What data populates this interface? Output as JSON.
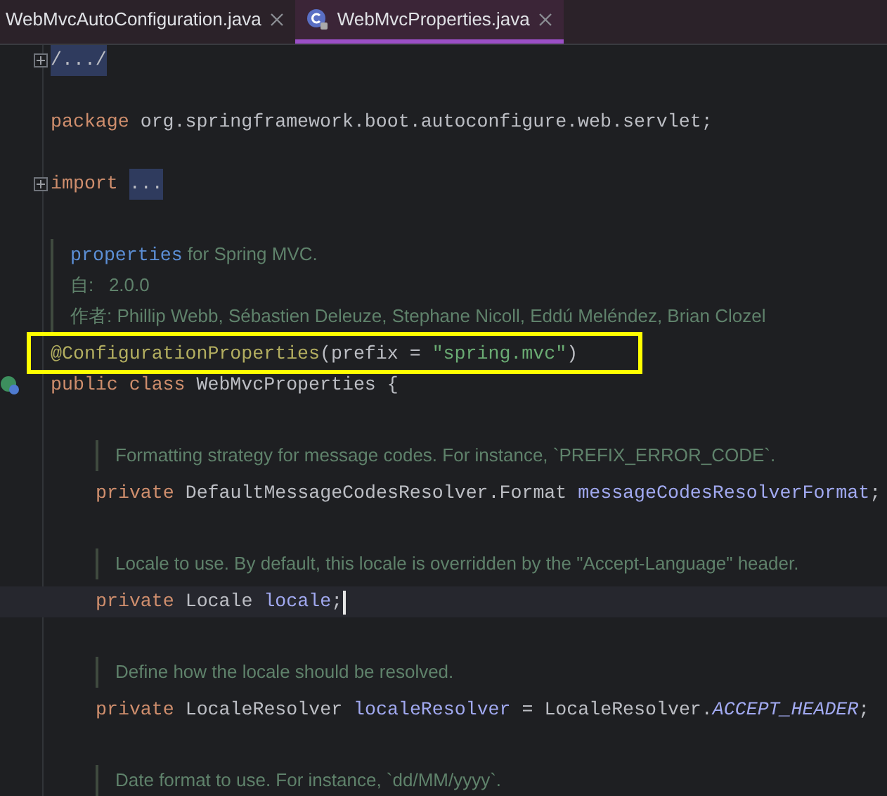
{
  "tabs": [
    {
      "label": "WebMvcAutoConfiguration.java",
      "selected": false
    },
    {
      "label": "WebMvcProperties.java",
      "selected": true
    }
  ],
  "lines": [
    {
      "kind": "code",
      "fold": true,
      "tokens": [
        {
          "kind": "folded",
          "text": "/.../"
        }
      ]
    },
    {
      "kind": "blank"
    },
    {
      "kind": "code",
      "tokens": [
        {
          "kind": "keyword",
          "text": "package "
        },
        {
          "kind": "plain",
          "text": "org.springframework.boot.autoconfigure.web.servlet;"
        }
      ]
    },
    {
      "kind": "blank"
    },
    {
      "kind": "code",
      "fold": true,
      "tokens": [
        {
          "kind": "keyword",
          "text": "import "
        },
        {
          "kind": "folded",
          "text": "..."
        }
      ]
    },
    {
      "kind": "blank"
    },
    {
      "kind": "doc",
      "rows": [
        [
          {
            "kind": "link",
            "text": "properties"
          },
          {
            "kind": "text",
            "text": " for Spring MVC."
          }
        ],
        [
          {
            "kind": "text",
            "text": "自:   2.0.0"
          }
        ],
        [
          {
            "kind": "text",
            "text": "作者: Phillip Webb, Sébastien Deleuze, Stephane Nicoll, Eddú Meléndez, Brian Clozel"
          }
        ]
      ]
    },
    {
      "kind": "code",
      "boxed": true,
      "tokens": [
        {
          "kind": "annotation",
          "text": "@ConfigurationProperties"
        },
        {
          "kind": "plain",
          "text": "(prefix = "
        },
        {
          "kind": "string",
          "text": "\"spring.mvc\""
        },
        {
          "kind": "plain",
          "text": ")"
        }
      ]
    },
    {
      "kind": "code",
      "gutter": true,
      "tokens": [
        {
          "kind": "keyword",
          "text": "public class "
        },
        {
          "kind": "plain",
          "text": "WebMvcProperties {"
        }
      ],
      "children": [
        {
          "kind": "blank"
        },
        {
          "kind": "doc",
          "rows": [
            [
              {
                "kind": "text",
                "text": "Formatting strategy for message codes. For instance, `PREFIX_ERROR_CODE`."
              }
            ]
          ]
        },
        {
          "kind": "code",
          "tokens": [
            {
              "kind": "keyword",
              "text": "private "
            },
            {
              "kind": "plain",
              "text": "DefaultMessageCodesResolver.Format "
            },
            {
              "kind": "field",
              "text": "messageCodesResolverFormat"
            },
            {
              "kind": "plain",
              "text": ";"
            }
          ]
        },
        {
          "kind": "blank"
        },
        {
          "kind": "doc",
          "rows": [
            [
              {
                "kind": "text",
                "text": "Locale to use. By default, this locale is overridden by the \"Accept-Language\" header."
              }
            ]
          ]
        },
        {
          "kind": "code",
          "current": true,
          "tokens": [
            {
              "kind": "keyword",
              "text": "private "
            },
            {
              "kind": "plain",
              "text": "Locale "
            },
            {
              "kind": "field",
              "text": "locale"
            },
            {
              "kind": "plain",
              "text": ";"
            }
          ]
        },
        {
          "kind": "blank"
        },
        {
          "kind": "doc",
          "rows": [
            [
              {
                "kind": "text",
                "text": "Define how the locale should be resolved."
              }
            ]
          ]
        },
        {
          "kind": "code",
          "tokens": [
            {
              "kind": "keyword",
              "text": "private "
            },
            {
              "kind": "plain",
              "text": "LocaleResolver "
            },
            {
              "kind": "field",
              "text": "localeResolver"
            },
            {
              "kind": "plain",
              "text": " = LocaleResolver."
            },
            {
              "kind": "constant",
              "text": "ACCEPT_HEADER"
            },
            {
              "kind": "plain",
              "text": ";"
            }
          ]
        },
        {
          "kind": "blank"
        },
        {
          "kind": "doc",
          "rows": [
            [
              {
                "kind": "text",
                "text": "Date format to use. For instance, `dd/MM/yyyy`."
              }
            ]
          ]
        }
      ]
    }
  ]
}
